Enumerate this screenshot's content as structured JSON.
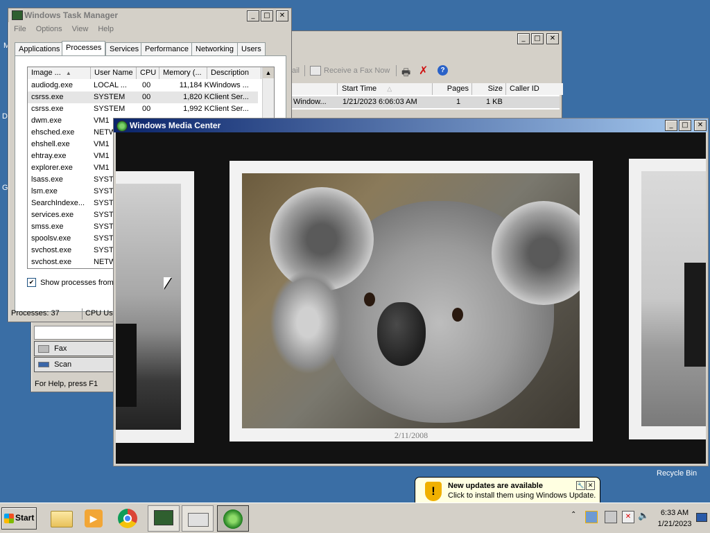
{
  "desktop": {
    "recycle_bin_label": "Recycle Bin",
    "edge_letters": [
      "M",
      "D",
      "G"
    ]
  },
  "task_manager": {
    "title": "Windows Task Manager",
    "menu": [
      "File",
      "Options",
      "View",
      "Help"
    ],
    "tabs": [
      "Applications",
      "Processes",
      "Services",
      "Performance",
      "Networking",
      "Users"
    ],
    "active_tab": "Processes",
    "columns": [
      "Image ...",
      "User Name",
      "CPU",
      "Memory (...",
      "Description"
    ],
    "processes": [
      {
        "image": "audiodg.exe",
        "user": "LOCAL ...",
        "cpu": "00",
        "memory": "11,184 K",
        "description": "Windows ..."
      },
      {
        "image": "csrss.exe",
        "user": "SYSTEM",
        "cpu": "00",
        "memory": "1,820 K",
        "description": "Client Ser..."
      },
      {
        "image": "csrss.exe",
        "user": "SYSTEM",
        "cpu": "00",
        "memory": "1,992 K",
        "description": "Client Ser..."
      },
      {
        "image": "dwm.exe",
        "user": "VM1"
      },
      {
        "image": "ehsched.exe",
        "user": "NETW"
      },
      {
        "image": "ehshell.exe",
        "user": "VM1"
      },
      {
        "image": "ehtray.exe",
        "user": "VM1"
      },
      {
        "image": "explorer.exe",
        "user": "VM1"
      },
      {
        "image": "lsass.exe",
        "user": "SYSTE"
      },
      {
        "image": "lsm.exe",
        "user": "SYSTE"
      },
      {
        "image": "SearchIndexe...",
        "user": "SYSTE"
      },
      {
        "image": "services.exe",
        "user": "SYSTE"
      },
      {
        "image": "smss.exe",
        "user": "SYSTE"
      },
      {
        "image": "spoolsv.exe",
        "user": "SYSTE"
      },
      {
        "image": "svchost.exe",
        "user": "SYSTE"
      },
      {
        "image": "svchost.exe",
        "user": "NETW"
      }
    ],
    "show_all_label": "Show processes from a",
    "show_all_checked": true,
    "status_processes": "Processes: 37",
    "status_cpu": "CPU Usa"
  },
  "fax_window": {
    "toolbar_partial": "ail",
    "receive_fax_now": "Receive a Fax Now",
    "columns": [
      "Start Time",
      "Pages",
      "Size",
      "Caller ID"
    ],
    "row": {
      "from": "Window...",
      "start_time": "1/21/2023 6:06:03 AM",
      "pages": "1",
      "size": "1 KB"
    },
    "nav_items": [
      "Fax",
      "Scan"
    ],
    "status": "For Help, press F1"
  },
  "media_center": {
    "title": "Windows Media Center",
    "photo_date": "2/11/2008"
  },
  "notification": {
    "title": "New updates are available",
    "body": "Click to install them using Windows Update."
  },
  "taskbar": {
    "start_label": "Start",
    "time": "6:33 AM",
    "date": "1/21/2023"
  },
  "colors": {
    "desktop": "#3a6ea5",
    "taskbar": "#d4d0c8",
    "media_title_left": "#0a246a",
    "media_title_right": "#a6caf0"
  }
}
